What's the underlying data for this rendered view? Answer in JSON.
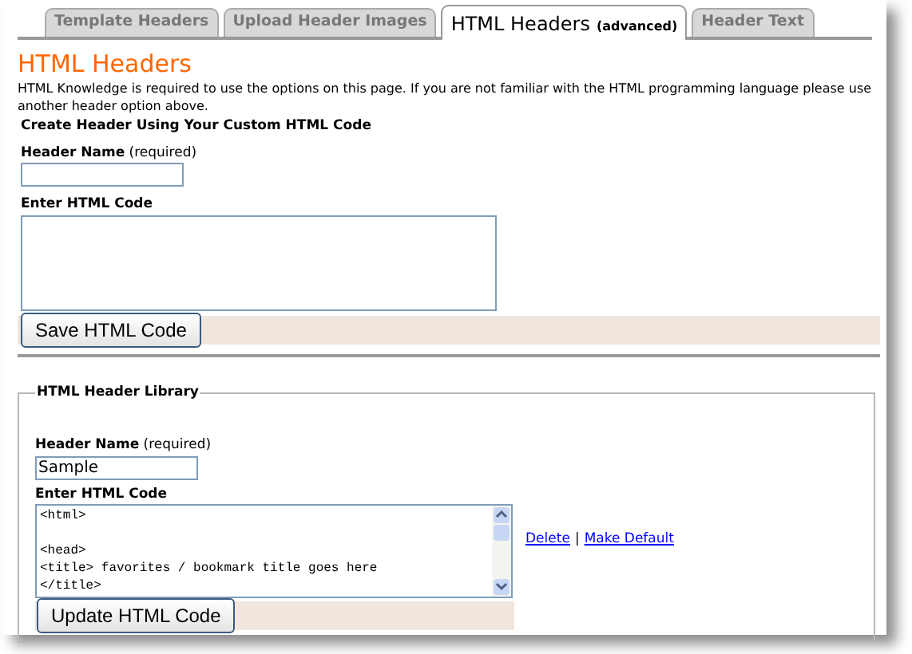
{
  "tabs": [
    {
      "label": "Template Headers",
      "selected": false
    },
    {
      "label": "Upload Header Images",
      "selected": false
    },
    {
      "label": "HTML Headers",
      "note": "(advanced)",
      "selected": true
    },
    {
      "label": "Header Text",
      "selected": false
    }
  ],
  "heading": "HTML Headers",
  "intro": "HTML Knowledge is required to use the options on this page. If you are not familiar with the HTML programming language please use another header option above.",
  "create": {
    "title": "Create Header Using Your Custom HTML Code",
    "name_label": "**Header Name** (required)",
    "code_label": "Enter HTML Code",
    "button": "Save HTML Code"
  },
  "library": {
    "legend": "HTML Header Library",
    "name_label": "**Header Name** (required)",
    "name_value": "Sample",
    "code_label": "Enter HTML Code",
    "code_value": "<html>\n\n<head>\n<title> favorites / bookmark title goes here\n</title>",
    "links": [
      "Delete",
      "Make Default"
    ],
    "separator": "|",
    "button": "Update HTML Code"
  }
}
